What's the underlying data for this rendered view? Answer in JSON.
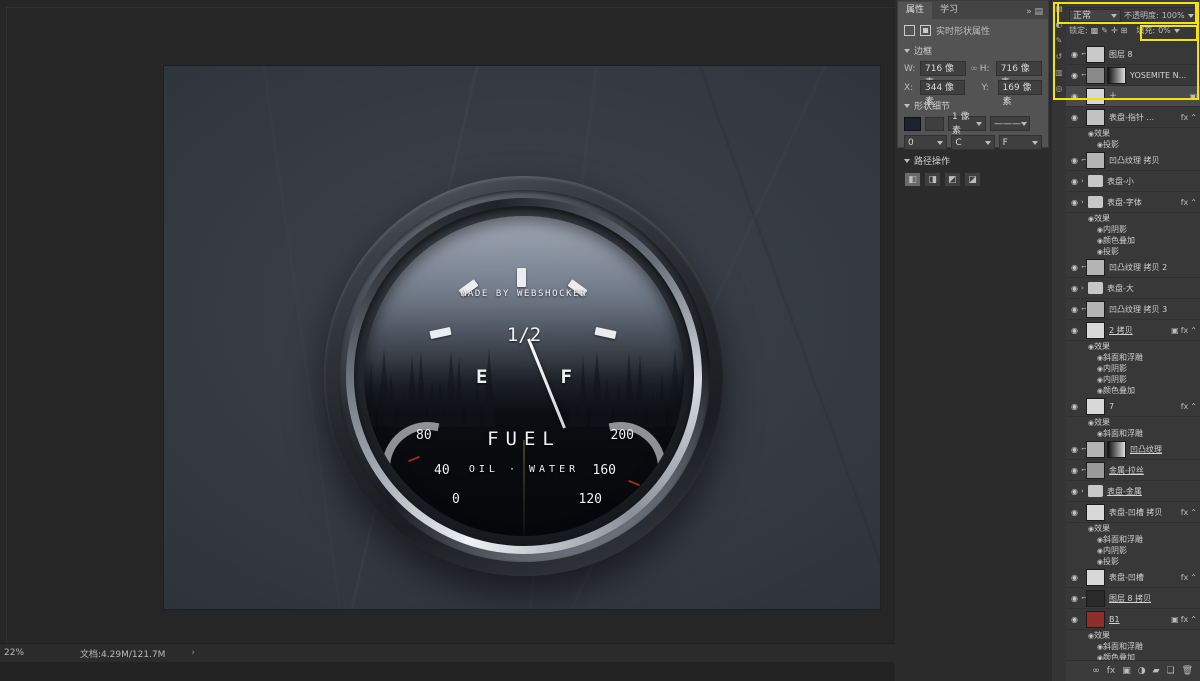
{
  "app": {
    "status_bar": {
      "zoom": "22%",
      "doc_info": "文档:4.29M/121.7M",
      "expand_arrow": "›"
    }
  },
  "properties_panel": {
    "tabs": [
      {
        "label": "属性",
        "active": true
      },
      {
        "label": "学习",
        "active": false
      }
    ],
    "collapse_icon": "»",
    "menu_icon": "▤",
    "title": "实时形状属性",
    "sections": {
      "border": {
        "label": "边框",
        "fields": [
          {
            "label": "W:",
            "value": "716 像素"
          },
          {
            "label": "H:",
            "value": "716 像素"
          },
          {
            "label": "X:",
            "value": "344 像素"
          },
          {
            "label": "Y:",
            "value": "169 像素"
          }
        ],
        "link_icon": "∞"
      },
      "shape_detail": {
        "label": "形状细节",
        "fill_color": "#1e2230",
        "stroke_width": "1 像素",
        "stroke_style": "———",
        "align_value": "0",
        "cap_value": "C",
        "corner_value": "F"
      },
      "path_ops": {
        "label": "路径操作",
        "buttons": [
          "combine-shapes",
          "subtract-front",
          "intersect-shapes",
          "exclude-overlap"
        ]
      }
    }
  },
  "layers_panel": {
    "blend_mode": "正常",
    "opacity_label": "不透明度:",
    "opacity_value": "100%",
    "lock_label": "锁定:",
    "lock_icons": [
      "透明像素",
      "画笔",
      "移动",
      "嵌套",
      "全部"
    ],
    "fill_label": "填充:",
    "fill_value": "0%",
    "bottom_buttons": [
      "link-icon",
      "fx-icon",
      "mask-icon",
      "adjustment-icon",
      "group-icon",
      "new-layer-icon",
      "delete-icon"
    ],
    "rows": [
      {
        "kind": "layer",
        "name": "图层 8",
        "visible": true,
        "selected": false,
        "thumb": "#c9c9c9",
        "fx": false,
        "clipped": true
      },
      {
        "kind": "layer",
        "name": "YOSEMITE N...",
        "visible": true,
        "selected": false,
        "thumb": "#8a8a8a",
        "fx": false,
        "clipped": true,
        "masked": true
      },
      {
        "kind": "layer",
        "name": "土",
        "visible": true,
        "selected": true,
        "thumb": "#d8d8d8",
        "fx": false,
        "badge": true
      },
      {
        "kind": "layer",
        "name": "表盘-指针 ...",
        "visible": true,
        "selected": false,
        "thumb": "#c2c2c2",
        "fx": true
      },
      {
        "kind": "effects",
        "name": "效果",
        "indent": 1
      },
      {
        "kind": "effect",
        "name": "投影",
        "indent": 2
      },
      {
        "kind": "layer",
        "name": "凹凸纹理 拷贝",
        "visible": true,
        "selected": false,
        "thumb": "#b4b4b4",
        "clipped": true
      },
      {
        "kind": "group",
        "name": "表盘-小",
        "visible": true
      },
      {
        "kind": "group",
        "name": "表盘-字体",
        "visible": true,
        "fx": true
      },
      {
        "kind": "effects",
        "name": "效果",
        "indent": 1
      },
      {
        "kind": "effect",
        "name": "内阴影",
        "indent": 2
      },
      {
        "kind": "effect",
        "name": "颜色叠加",
        "indent": 2
      },
      {
        "kind": "effect",
        "name": "投影",
        "indent": 2
      },
      {
        "kind": "layer",
        "name": "凹凸纹理 拷贝 2",
        "visible": true,
        "thumb": "#b4b4b4",
        "clipped": true
      },
      {
        "kind": "group",
        "name": "表盘-大",
        "visible": true
      },
      {
        "kind": "layer",
        "name": "凹凸纹理 拷贝 3",
        "visible": true,
        "thumb": "#b4b4b4",
        "clipped": true
      },
      {
        "kind": "layer",
        "name": "2 拷贝",
        "visible": true,
        "thumb": "#d8d8d8",
        "fx": true,
        "badge": true,
        "underline": true
      },
      {
        "kind": "effects",
        "name": "效果",
        "indent": 1
      },
      {
        "kind": "effect",
        "name": "斜面和浮雕",
        "indent": 2
      },
      {
        "kind": "effect",
        "name": "内阴影",
        "indent": 2
      },
      {
        "kind": "effect",
        "name": "内阴影",
        "indent": 2
      },
      {
        "kind": "effect",
        "name": "颜色叠加",
        "indent": 2
      },
      {
        "kind": "layer",
        "name": "7",
        "visible": true,
        "thumb": "#d8d8d8",
        "fx": true
      },
      {
        "kind": "effects",
        "name": "效果",
        "indent": 1
      },
      {
        "kind": "effect",
        "name": "斜面和浮雕",
        "indent": 2
      },
      {
        "kind": "layer",
        "name": "凹凸纹理",
        "visible": true,
        "thumb": "#b4b4b4",
        "clipped": true,
        "masked": true,
        "underline": true
      },
      {
        "kind": "layer",
        "name": "金属-拉丝",
        "visible": true,
        "thumb": "#9a9a9a",
        "clipped": true,
        "underline": true
      },
      {
        "kind": "group",
        "name": "表盘-金属",
        "visible": true,
        "underline": true
      },
      {
        "kind": "layer",
        "name": "表盘-凹槽 拷贝",
        "visible": true,
        "thumb": "#d8d8d8",
        "fx": true
      },
      {
        "kind": "effects",
        "name": "效果",
        "indent": 1
      },
      {
        "kind": "effect",
        "name": "斜面和浮雕",
        "indent": 2
      },
      {
        "kind": "effect",
        "name": "内阴影",
        "indent": 2
      },
      {
        "kind": "effect",
        "name": "投影",
        "indent": 2
      },
      {
        "kind": "layer",
        "name": "表盘-凹槽",
        "visible": true,
        "thumb": "#d8d8d8",
        "fx": true
      },
      {
        "kind": "layer",
        "name": "图层 8 拷贝",
        "visible": true,
        "thumb": "#2a2a2a",
        "clipped": true,
        "underline": true
      },
      {
        "kind": "layer",
        "name": "B1",
        "visible": true,
        "thumb": "#8e2f2b",
        "fx": true,
        "badge": true,
        "underline": true
      },
      {
        "kind": "effects",
        "name": "效果",
        "indent": 1
      },
      {
        "kind": "effect",
        "name": "斜面和浮雕",
        "indent": 2
      },
      {
        "kind": "effect",
        "name": "颜色叠加",
        "indent": 2
      }
    ]
  },
  "gauge": {
    "brand_text": "MADE BY WEBSHOCKER",
    "center_label": "1/2",
    "left_label": "E",
    "right_label": "F",
    "title": "FUEL",
    "subtitle": "OIL · WATER",
    "left_scale": [
      "80",
      "40",
      "0"
    ],
    "right_scale": [
      "200",
      "160",
      "120"
    ],
    "needle_angle_deg": -22
  },
  "colors": {
    "highlight": "#f5e400",
    "panel_bg": "#383838",
    "props_bg": "#535353",
    "canvas_bg": "#262626"
  }
}
